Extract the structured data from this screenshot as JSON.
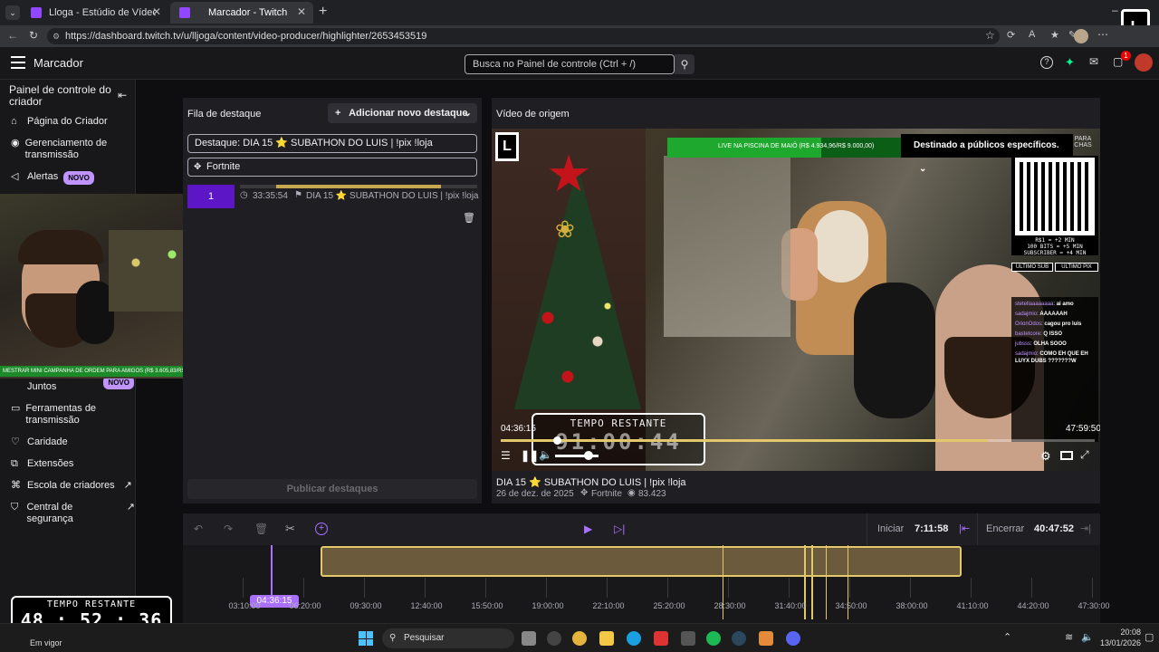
{
  "browser": {
    "tabs": [
      {
        "title": "Lloga - Estúdio de Vídeo - Twitch"
      },
      {
        "title": "Marcador - Twitch"
      }
    ],
    "url": "https://dashboard.twitch.tv/u/lljoga/content/video-producer/highlighter/2653453519"
  },
  "topnav": {
    "title": "Marcador",
    "search_placeholder": "Busca no Painel de controle (Ctrl + /)",
    "notif_count": "1"
  },
  "sidebar": {
    "title": "Painel de controle do criador",
    "items": [
      {
        "label": "Página do Criador",
        "icon": "home-icon"
      },
      {
        "label": "Gerenciamento de transmissão",
        "icon": "broadcast-icon"
      },
      {
        "label": "Alertas",
        "badge": "NOVO",
        "icon": "megaphone-icon"
      },
      {
        "label": "Juntos",
        "badge": "NOVO",
        "icon": "users-icon"
      },
      {
        "label": "Ferramentas de transmissão",
        "icon": "video-icon"
      },
      {
        "label": "Caridade",
        "icon": "charity-icon"
      },
      {
        "label": "Extensões",
        "icon": "extension-icon"
      },
      {
        "label": "Escola de criadores",
        "icon": "school-icon"
      },
      {
        "label": "Central de segurança",
        "icon": "shield-icon"
      }
    ]
  },
  "cam_overlay": {
    "bar_text": "MESTRAR MINI CAMPANHA DE ORDEM PARA AMIGOS (R$ 3.605,83/R$ 15.000,00)"
  },
  "queue": {
    "header": "Fila de destaque",
    "add_button": "Adicionar novo destaque",
    "highlight_field": "Destaque: DIA 15 ⭐ SUBATHON DO LUIS | !pix !loja",
    "category_field": "Fortnite",
    "item": {
      "index": "1",
      "time": "33:35:54",
      "title": "DIA 15 ⭐ SUBATHON DO LUIS | !pix !loja"
    },
    "publish_button": "Publicar destaques"
  },
  "source": {
    "header": "Vídeo de origem",
    "video_title": "DIA 15 ⭐ SUBATHON DO LUIS | !pix !loja",
    "date": "26 de dez. de 2025",
    "category": "Fortnite",
    "views": "83.423",
    "current_time": "04:36:15",
    "end_time": "47:59:50",
    "overlay_banner": "LIVE NA PISCINA DE MAIÔ (R$ 4.934,96/R$ 9.000,00)",
    "audience_label": "Destinado a públicos específicos.",
    "overlay_timer_label": "TEMPO RESTANTE",
    "overlay_timer_value": "91:00:44",
    "qr_lines": [
      "R$1 = +2 MIN",
      "100 BITS = +5 MIN",
      "SUBSCRIBER = +4 MIN"
    ],
    "last_sub": "ULTIMO SUB",
    "last_pix": "ULTIMO PIX",
    "para_chas": "PARA CHAS",
    "chat": [
      {
        "user": "stetellaaaaaaaa",
        "msg": "ai amo"
      },
      {
        "user": "sadajmio",
        "msg": "AAAAAAH"
      },
      {
        "user": "OrionOdos",
        "msg": "cagou pro luis"
      },
      {
        "user": "bastetcore",
        "msg": "Q ISSO"
      },
      {
        "user": "jubsss",
        "msg": "OLHA SOOO"
      },
      {
        "user": "sadajmio",
        "msg": "COMO EH QUE EH LUYX DUBS ???????W"
      }
    ]
  },
  "timeline": {
    "undo": "undo",
    "start_label": "Iniciar",
    "start_value": "7:11:58",
    "end_label": "Encerrar",
    "end_value": "40:47:52",
    "playhead": "04:36:15",
    "ticks": [
      "03:10:00",
      "06:20:00",
      "09:30:00",
      "12:40:00",
      "15:50:00",
      "19:00:00",
      "22:10:00",
      "25:20:00",
      "28:30:00",
      "31:40:00",
      "34:50:00",
      "38:00:00",
      "41:10:00",
      "44:20:00",
      "47:30:00"
    ]
  },
  "stream_timer": {
    "label": "TEMPO RESTANTE",
    "value": "48 : 52 : 36",
    "status": "Em vigor"
  },
  "taskbar": {
    "search": "Pesquisar",
    "time": "20:08",
    "date": "13/01/2026"
  }
}
